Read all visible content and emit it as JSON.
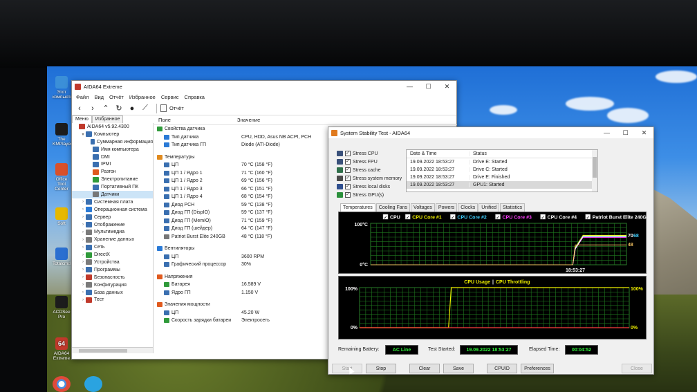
{
  "desktop": {
    "icons": [
      {
        "label": "Этот компьютер"
      },
      {
        "label": "The KMPlayer"
      },
      {
        "label": "Office Tool Center"
      },
      {
        "label": "Soft"
      },
      {
        "label": "Totalcmd"
      },
      {
        "label": "ACDSee Pro"
      },
      {
        "label": "AIDA64 Extreme"
      }
    ]
  },
  "aida": {
    "title": "AIDA64 Extreme",
    "menu": [
      "Файл",
      "Вид",
      "Отчёт",
      "Избранное",
      "Сервис",
      "Справка"
    ],
    "toolbar_report": "Отчёт",
    "tabs": [
      "Меню",
      "Избранное"
    ],
    "tree": [
      {
        "label": "AIDA64 v5.92.4300",
        "indent": 0,
        "arrow": "",
        "color": "#c0392b"
      },
      {
        "label": "Компьютер",
        "indent": 1,
        "arrow": "▾",
        "color": "#3a6fb0"
      },
      {
        "label": "Суммарная информация",
        "indent": 2,
        "arrow": "",
        "color": "#3a6fb0"
      },
      {
        "label": "Имя компьютера",
        "indent": 2,
        "arrow": "",
        "color": "#3a6fb0"
      },
      {
        "label": "DMI",
        "indent": 2,
        "arrow": "",
        "color": "#3a6fb0"
      },
      {
        "label": "IPMI",
        "indent": 2,
        "arrow": "",
        "color": "#3a6fb0"
      },
      {
        "label": "Разгон",
        "indent": 2,
        "arrow": "",
        "color": "#e05a1e"
      },
      {
        "label": "Электропитание",
        "indent": 2,
        "arrow": "",
        "color": "#2f9a3a"
      },
      {
        "label": "Портативный ПК",
        "indent": 2,
        "arrow": "",
        "color": "#3a6fb0"
      },
      {
        "label": "Датчики",
        "indent": 2,
        "arrow": "",
        "color": "#777777",
        "selected": true
      },
      {
        "label": "Системная плата",
        "indent": 1,
        "arrow": "›",
        "color": "#3a6fb0"
      },
      {
        "label": "Операционная система",
        "indent": 1,
        "arrow": "›",
        "color": "#2a7ad6"
      },
      {
        "label": "Сервер",
        "indent": 1,
        "arrow": "›",
        "color": "#3a6fb0"
      },
      {
        "label": "Отображение",
        "indent": 1,
        "arrow": "›",
        "color": "#3a6fb0"
      },
      {
        "label": "Мультимедиа",
        "indent": 1,
        "arrow": "›",
        "color": "#7a7a7a"
      },
      {
        "label": "Хранение данных",
        "indent": 1,
        "arrow": "›",
        "color": "#7a7a7a"
      },
      {
        "label": "Сеть",
        "indent": 1,
        "arrow": "›",
        "color": "#3a6fb0"
      },
      {
        "label": "DirectX",
        "indent": 1,
        "arrow": "›",
        "color": "#2f9a3a"
      },
      {
        "label": "Устройства",
        "indent": 1,
        "arrow": "›",
        "color": "#7a7a7a"
      },
      {
        "label": "Программы",
        "indent": 1,
        "arrow": "›",
        "color": "#3a6fb0"
      },
      {
        "label": "Безопасность",
        "indent": 1,
        "arrow": "›",
        "color": "#c0392b"
      },
      {
        "label": "Конфигурация",
        "indent": 1,
        "arrow": "›",
        "color": "#7a7a7a"
      },
      {
        "label": "База данных",
        "indent": 1,
        "arrow": "›",
        "color": "#3a6fb0"
      },
      {
        "label": "Тест",
        "indent": 1,
        "arrow": "›",
        "color": "#c0392b"
      }
    ],
    "columns": {
      "field": "Поле",
      "value": "Значение"
    },
    "rows": [
      {
        "type": "sec",
        "field": "Свойства датчика",
        "value": "",
        "color": "#2f9a3a"
      },
      {
        "type": "item",
        "field": "Тип датчика",
        "value": "CPU, HDD, Asus NB ACPI, PCH",
        "color": "#2a7ad6"
      },
      {
        "type": "item",
        "field": "Тип датчика ГП",
        "value": "Diode  (ATI-Diode)",
        "color": "#2a7ad6"
      },
      {
        "type": "gap"
      },
      {
        "type": "sec",
        "field": "Температуры",
        "value": "",
        "color": "#e08a1e"
      },
      {
        "type": "item",
        "field": "ЦП",
        "value": "70 °C  (158 °F)",
        "color": "#3a6fb0"
      },
      {
        "type": "item",
        "field": "ЦП 1 / Ядро 1",
        "value": "71 °C  (160 °F)",
        "color": "#3a6fb0"
      },
      {
        "type": "item",
        "field": "ЦП 1 / Ядро 2",
        "value": "69 °C  (156 °F)",
        "color": "#3a6fb0"
      },
      {
        "type": "item",
        "field": "ЦП 1 / Ядро 3",
        "value": "66 °C  (151 °F)",
        "color": "#3a6fb0"
      },
      {
        "type": "item",
        "field": "ЦП 1 / Ядро 4",
        "value": "68 °C  (154 °F)",
        "color": "#3a6fb0"
      },
      {
        "type": "item",
        "field": "Диод PCH",
        "value": "59 °C  (138 °F)",
        "color": "#3a6fb0"
      },
      {
        "type": "item",
        "field": "Диод ГП (DispIO)",
        "value": "59 °C  (137 °F)",
        "color": "#3a6fb0"
      },
      {
        "type": "item",
        "field": "Диод ГП (MemIO)",
        "value": "71 °C  (159 °F)",
        "color": "#3a6fb0"
      },
      {
        "type": "item",
        "field": "Диод ГП (шейдер)",
        "value": "64 °C  (147 °F)",
        "color": "#3a6fb0"
      },
      {
        "type": "item",
        "field": "Patriot Burst Elite 240GB",
        "value": "48 °C  (118 °F)",
        "color": "#777777"
      },
      {
        "type": "gap"
      },
      {
        "type": "sec",
        "field": "Вентиляторы",
        "value": "",
        "color": "#2a7ad6"
      },
      {
        "type": "item",
        "field": "ЦП",
        "value": "3600 RPM",
        "color": "#3a6fb0"
      },
      {
        "type": "item",
        "field": "Графический процессор",
        "value": "30%",
        "color": "#3a6fb0"
      },
      {
        "type": "gap"
      },
      {
        "type": "sec",
        "field": "Напряжения",
        "value": "",
        "color": "#e05a1e"
      },
      {
        "type": "item",
        "field": "Батарея",
        "value": "16.589 V",
        "color": "#2f9a3a"
      },
      {
        "type": "item",
        "field": "Ядро ГП",
        "value": "1.150 V",
        "color": "#3a6fb0"
      },
      {
        "type": "gap"
      },
      {
        "type": "sec",
        "field": "Значения мощности",
        "value": "",
        "color": "#e05a1e"
      },
      {
        "type": "item",
        "field": "ЦП",
        "value": "45.20 W",
        "color": "#3a6fb0"
      },
      {
        "type": "item",
        "field": "Скорость зарядки батареи",
        "value": "Электросеть",
        "color": "#2f9a3a"
      }
    ]
  },
  "sst": {
    "title": "System Stability Test - AIDA64",
    "stress": [
      {
        "label": "Stress CPU",
        "checked": true
      },
      {
        "label": "Stress FPU",
        "checked": true
      },
      {
        "label": "Stress cache",
        "checked": true
      },
      {
        "label": "Stress system memory",
        "checked": true
      },
      {
        "label": "Stress local disks",
        "checked": true
      },
      {
        "label": "Stress GPU(s)",
        "checked": true
      }
    ],
    "log_headers": {
      "date": "Date & Time",
      "status": "Status"
    },
    "log": [
      {
        "date": "19.09.2022 18:53:27",
        "status": "Drive E: Started"
      },
      {
        "date": "19.09.2022 18:53:27",
        "status": "Drive C: Started"
      },
      {
        "date": "19.09.2022 18:53:27",
        "status": "Drive E: Finished"
      },
      {
        "date": "19.09.2022 18:53:27",
        "status": "GPU1: Started",
        "selected": true
      }
    ],
    "tabs": [
      "Temperatures",
      "Cooling Fans",
      "Voltages",
      "Powers",
      "Clocks",
      "Unified",
      "Statistics"
    ],
    "stats": {
      "battery_label": "Remaining Battery:",
      "battery_value": "AC Line",
      "started_label": "Test Started:",
      "started_value": "19.09.2022 18:53:27",
      "elapsed_label": "Elapsed Time:",
      "elapsed_value": "00:04:52"
    },
    "buttons": {
      "start": "Start",
      "stop": "Stop",
      "clear": "Clear",
      "save": "Save",
      "cpuid": "CPUID",
      "preferences": "Preferences",
      "close": "Close"
    }
  },
  "chart_data": [
    {
      "type": "line",
      "legend": [
        "CPU",
        "CPU Core #1",
        "CPU Core #2",
        "CPU Core #3",
        "CPU Core #4",
        "Patriot Burst Elite 240GB"
      ],
      "colors": [
        "#ffffff",
        "#f0f000",
        "#40d0ff",
        "#ff40ff",
        "#ffffff",
        "#ffffff"
      ],
      "ylim": [
        0,
        100
      ],
      "ytick_labels": [
        "100°C",
        "0°C"
      ],
      "xtick_labels": [
        "18:53:27"
      ],
      "right_labels": [
        "70",
        "68",
        "48"
      ],
      "series": [
        {
          "name": "CPU",
          "x": [
            0,
            0.79,
            0.8,
            0.83,
            1.0
          ],
          "values": [
            0,
            0,
            40,
            70,
            70
          ]
        },
        {
          "name": "CPU Core #1",
          "x": [
            0,
            0.79,
            0.8,
            0.83,
            1.0
          ],
          "values": [
            0,
            0,
            42,
            71,
            71
          ]
        },
        {
          "name": "CPU Core #2",
          "x": [
            0,
            0.79,
            0.8,
            0.83,
            1.0
          ],
          "values": [
            0,
            0,
            40,
            69,
            69
          ]
        },
        {
          "name": "CPU Core #3",
          "x": [
            0,
            0.79,
            0.8,
            0.83,
            1.0
          ],
          "values": [
            0,
            0,
            38,
            66,
            66
          ]
        },
        {
          "name": "CPU Core #4",
          "x": [
            0,
            0.79,
            0.8,
            0.83,
            1.0
          ],
          "values": [
            0,
            0,
            39,
            68,
            68
          ]
        },
        {
          "name": "Patriot Burst Elite 240GB",
          "x": [
            0,
            0.79,
            0.8,
            1.0
          ],
          "values": [
            0,
            0,
            48,
            48
          ]
        }
      ]
    },
    {
      "type": "line",
      "title_left": "CPU Usage",
      "title_sep": "|",
      "title_right": "CPU Throttling",
      "ylim": [
        0,
        100
      ],
      "ytick_labels": [
        "100%",
        "0%"
      ],
      "right_labels": [
        "100%",
        "0%"
      ],
      "series": [
        {
          "name": "CPU Usage",
          "x": [
            0,
            0.33,
            0.34,
            1.0
          ],
          "values": [
            0,
            0,
            100,
            100
          ]
        },
        {
          "name": "CPU Throttling",
          "x": [
            0,
            1.0
          ],
          "values": [
            0,
            0
          ]
        }
      ]
    }
  ]
}
